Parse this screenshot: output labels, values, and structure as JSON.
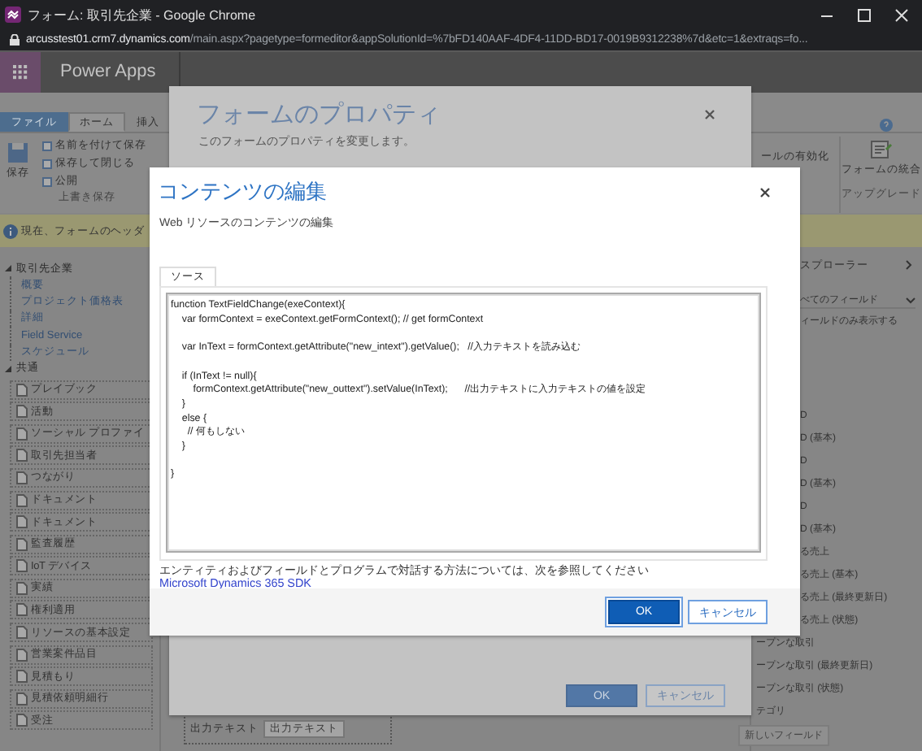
{
  "window": {
    "title": "フォーム: 取引先企業 - Google Chrome",
    "url_host": "arcusstest01.crm7.dynamics.com",
    "url_path": "/main.aspx?pagetype=formeditor&appSolutionId=%7bFD140AAF-4DF4-11DD-BD17-0019B9312238%7d&etc=1&extraqs=fo..."
  },
  "app": {
    "name": "Power Apps"
  },
  "ribbon": {
    "tabs": [
      {
        "label": "ファイル",
        "kind": "file",
        "selected": false
      },
      {
        "label": "ホーム",
        "kind": "tab",
        "selected": true
      },
      {
        "label": "挿入",
        "kind": "tab",
        "selected": false
      }
    ],
    "save": "保存",
    "commands": [
      "名前を付けて保存",
      "保存して閉じる",
      "公開"
    ],
    "group_label": "上書き保存",
    "partial_command": "ールの有効化",
    "merge": "フォームの統合",
    "right_group_label": "アップグレード"
  },
  "notice": "現在、フォームのヘッダ",
  "nav": [
    {
      "label": "取引先企業",
      "kind": "links",
      "expanded": true,
      "children": [
        {
          "label": "概要"
        },
        {
          "label": "プロジェクト価格表"
        },
        {
          "label": "詳細"
        },
        {
          "label": "Field Service"
        },
        {
          "label": "スケジュール"
        }
      ]
    },
    {
      "label": "共通",
      "kind": "sections",
      "expanded": true,
      "children": [
        {
          "label": "プレイブック"
        },
        {
          "label": "活動"
        },
        {
          "label": "ソーシャル プロファイ"
        },
        {
          "label": "取引先担当者"
        },
        {
          "label": "つながり"
        },
        {
          "label": "ドキュメント"
        },
        {
          "label": "ドキュメント"
        },
        {
          "label": "監査履歴"
        },
        {
          "label": "IoT デバイス"
        },
        {
          "label": "実績"
        },
        {
          "label": "権利適用"
        },
        {
          "label": "リソースの基本設定"
        },
        {
          "label": "営業案件品目"
        },
        {
          "label": "見積もり"
        },
        {
          "label": "見積依頼明細行"
        },
        {
          "label": "受注"
        }
      ]
    }
  ],
  "canvas": {
    "field_label": "出力テキスト",
    "field_value": "出力テキスト"
  },
  "explorer": {
    "title": "スプローラー",
    "filter": "べてのフィールド",
    "option": "ィールドのみ表示する",
    "fields": [
      "D",
      "D (基本)",
      "D",
      "D (基本)",
      "D",
      "D (基本)",
      "る売上",
      "る売上 (基本)",
      "る売上 (最終更新日)",
      "る売上 (状態)",
      "ープンな取引",
      "ープンな取引 (最終更新日)",
      "ープンな取引 (状態)",
      "テゴリ"
    ],
    "new_field": "新しいフィールド"
  },
  "form_properties": {
    "title": "フォームのプロパティ",
    "subtitle": "このフォームのプロパティを変更します。",
    "buttons": [
      {
        "label": "OK",
        "kind": "primary"
      },
      {
        "label": "キャンセル",
        "kind": "secondary"
      }
    ]
  },
  "content_editor": {
    "title": "コンテンツの編集",
    "subtitle": "Web リソースのコンテンツの編集",
    "tab": "ソース",
    "code": "function TextFieldChange(exeContext){\n    var formContext = exeContext.getFormContext(); // get formContext\n\n    var InText = formContext.getAttribute(\"new_intext\").getValue();   //入力テキストを読み込む\n\n    if (InText != null){\n        formContext.getAttribute(\"new_outtext\").setValue(InText);      //出力テキストに入力テキストの値を設定\n    }\n    else {\n      // 何もしない\n    }\n\n}",
    "help_text": "エンティティおよびフィールドとプログラムで対話する方法については、次を参照してください",
    "help_link": "Microsoft Dynamics 365 SDK",
    "buttons": [
      {
        "label": "OK",
        "kind": "primary"
      },
      {
        "label": "キャンセル",
        "kind": "secondary"
      }
    ]
  }
}
